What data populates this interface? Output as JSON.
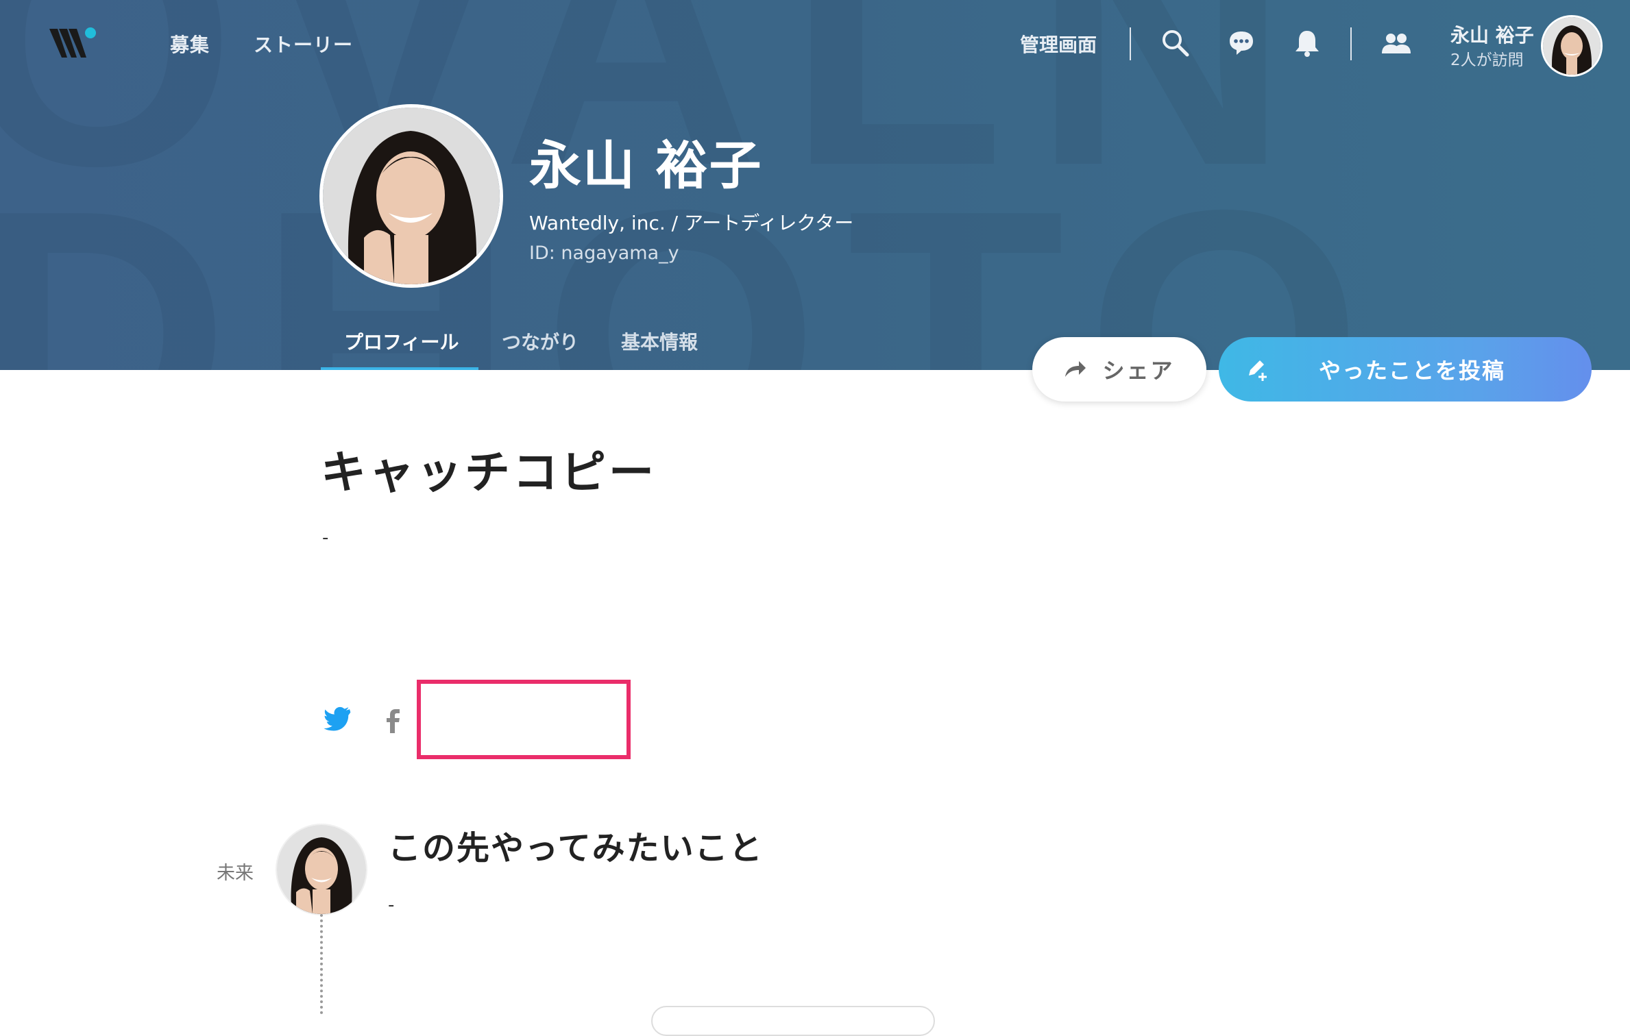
{
  "header": {
    "nav": [
      "募集",
      "ストーリー"
    ],
    "admin_label": "管理画面",
    "user_name": "永山 裕子",
    "visit_text": "2人が訪問"
  },
  "profile": {
    "name": "永山 裕子",
    "role": "Wantedly, inc. / アートディレクター",
    "id_text": "ID: nagayama_y"
  },
  "tabs": [
    {
      "label": "プロフィール",
      "active": true
    },
    {
      "label": "つながり",
      "active": false
    },
    {
      "label": "基本情報",
      "active": false
    }
  ],
  "actions": {
    "share_label": "シェア",
    "post_label": "やったことを投稿"
  },
  "catchcopy": {
    "title": "キャッチコピー",
    "text": "-"
  },
  "social": [
    "twitter-icon",
    "facebook-icon"
  ],
  "timeline": {
    "label": "未来",
    "title": "この先やってみたいこと",
    "text": "-"
  },
  "colors": {
    "hero": "#3d6289",
    "accent": "#3bb5e8",
    "highlight": "#ea2d6a",
    "post_gradient_start": "#3fb8e6",
    "post_gradient_end": "#648fec"
  }
}
